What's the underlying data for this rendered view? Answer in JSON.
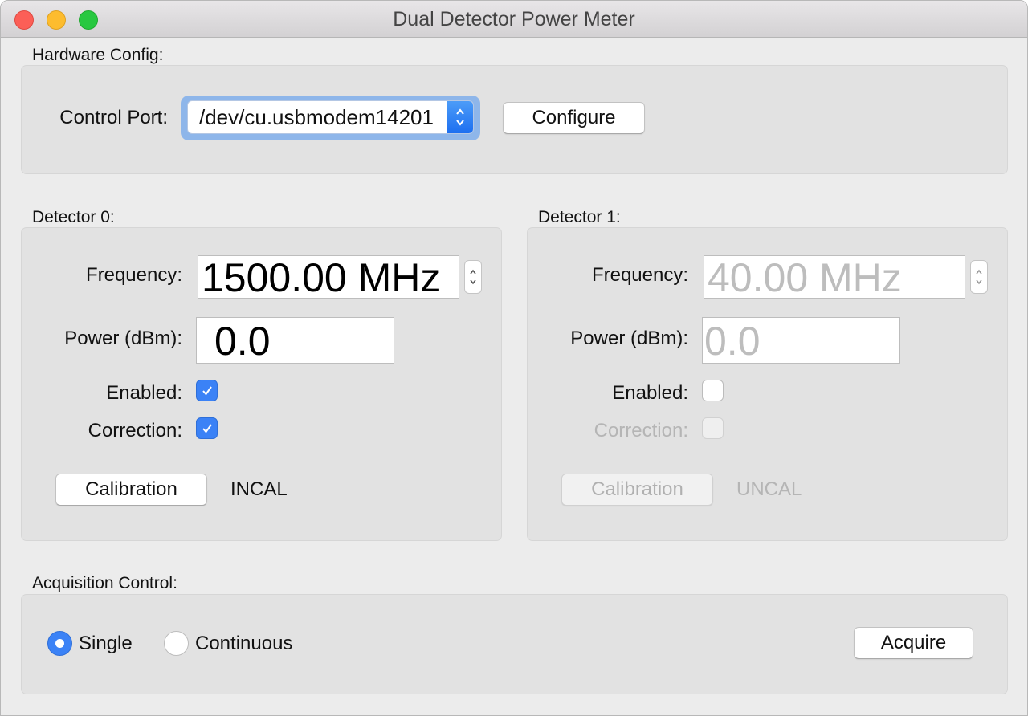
{
  "window": {
    "title": "Dual Detector Power Meter",
    "traffic_lights": [
      "close",
      "minimize",
      "maximize"
    ]
  },
  "hardware_config": {
    "section_label": "Hardware Config:",
    "control_port_label": "Control Port:",
    "control_port_value": "/dev/cu.usbmodem14201",
    "configure_button": "Configure"
  },
  "detectors": [
    {
      "section_label": "Detector 0:",
      "frequency_label": "Frequency:",
      "frequency_value": "1500.00 MHz",
      "power_label": "Power (dBm):",
      "power_value": "0.0",
      "enabled_label": "Enabled:",
      "enabled_checked": true,
      "correction_label": "Correction:",
      "correction_checked": true,
      "calibration_button": "Calibration",
      "calibration_status": "INCAL",
      "active": true
    },
    {
      "section_label": "Detector 1:",
      "frequency_label": "Frequency:",
      "frequency_value": "40.00 MHz",
      "power_label": "Power (dBm):",
      "power_value": "0.0",
      "enabled_label": "Enabled:",
      "enabled_checked": false,
      "correction_label": "Correction:",
      "correction_checked": false,
      "calibration_button": "Calibration",
      "calibration_status": "UNCAL",
      "active": false
    }
  ],
  "acquisition": {
    "section_label": "Acquisition Control:",
    "modes": [
      {
        "label": "Single",
        "selected": true
      },
      {
        "label": "Continuous",
        "selected": false
      }
    ],
    "acquire_button": "Acquire"
  },
  "colors": {
    "accent": "#3b82f6",
    "focus_ring": "#8eb6ea",
    "disabled_text": "#b5b5b5"
  }
}
